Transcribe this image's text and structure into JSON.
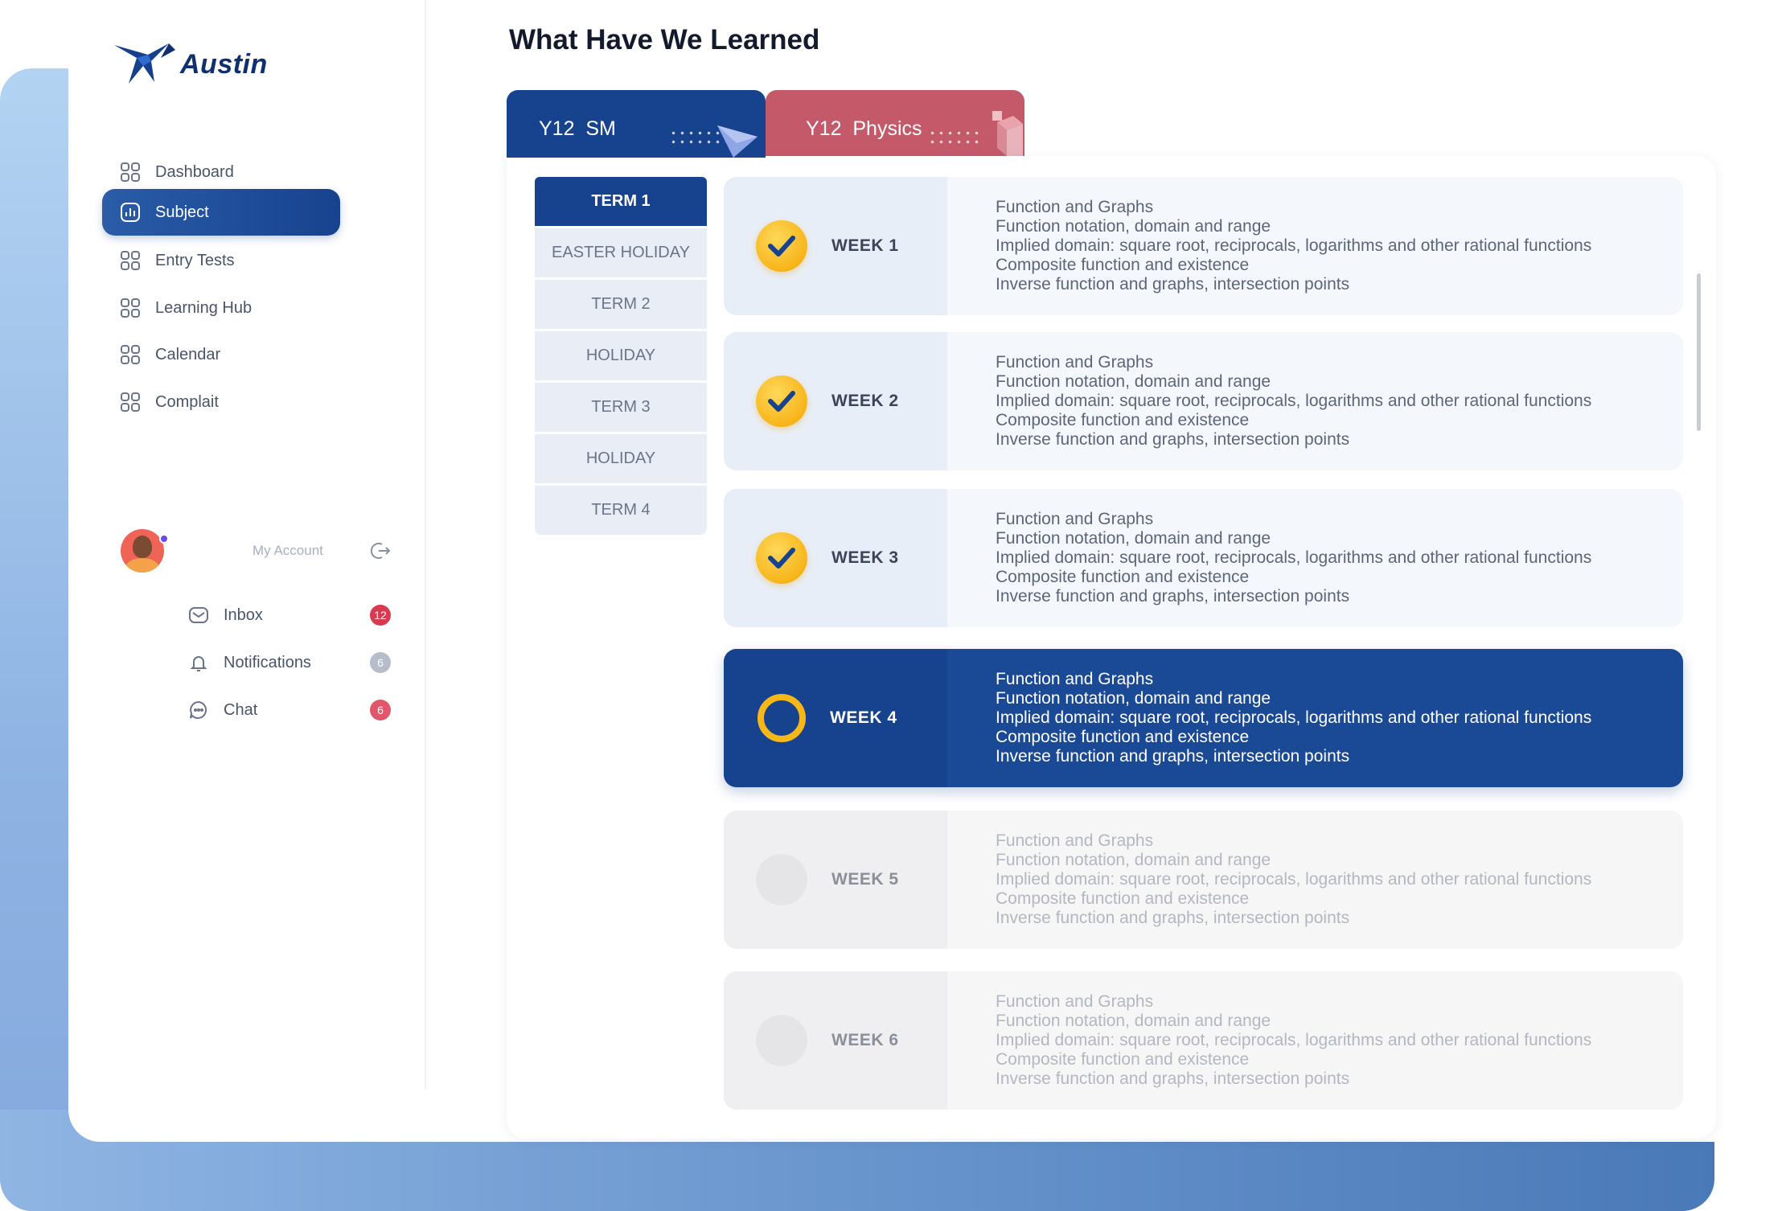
{
  "app": {
    "name": "Austin"
  },
  "nav": {
    "items": [
      {
        "label": "Dashboard"
      },
      {
        "label": "Subject"
      },
      {
        "label": "Entry Tests"
      },
      {
        "label": "Learning Hub"
      },
      {
        "label": "Calendar"
      },
      {
        "label": "Complait"
      }
    ]
  },
  "account": {
    "label": "My Account"
  },
  "side": {
    "inbox": {
      "label": "Inbox",
      "badge": "12",
      "badge_color": "#d83a52"
    },
    "notifications": {
      "label": "Notifications",
      "badge": "6",
      "badge_color": "#b6bcc9"
    },
    "chat": {
      "label": "Chat",
      "badge": "6",
      "badge_color": "#e0576c"
    }
  },
  "main": {
    "title": "What Have We Learned",
    "tabs": [
      {
        "label": "Y12  SM",
        "color": "#17428e"
      },
      {
        "label": "Y12  Physics",
        "color": "#c4596a"
      }
    ],
    "terms": [
      "TERM 1",
      "EASTER HOLIDAY",
      "TERM 2",
      "HOLIDAY",
      "TERM 3",
      "HOLIDAY",
      "TERM 4"
    ],
    "weeks": [
      {
        "label": "WEEK 1",
        "status": "done",
        "topics": [
          "Function and Graphs",
          "Function notation, domain and range",
          "Implied domain: square root, reciprocals, logarithms and other rational functions",
          "Composite function and existence",
          "Inverse function and graphs, intersection points"
        ]
      },
      {
        "label": "WEEK 2",
        "status": "done",
        "topics": [
          "Function and Graphs",
          "Function notation, domain and range",
          "Implied domain: square root, reciprocals, logarithms and other rational functions",
          "Composite function and existence",
          "Inverse function and graphs, intersection points"
        ]
      },
      {
        "label": "WEEK 3",
        "status": "done",
        "topics": [
          "Function and Graphs",
          "Function notation, domain and range",
          "Implied domain: square root, reciprocals, logarithms and other rational functions",
          "Composite function and existence",
          "Inverse function and graphs, intersection points"
        ]
      },
      {
        "label": "WEEK 4",
        "status": "current",
        "topics": [
          "Function and Graphs",
          "Function notation, domain and range",
          "Implied domain: square root, reciprocals, logarithms and other rational functions",
          "Composite function and existence",
          "Inverse function and graphs, intersection points"
        ]
      },
      {
        "label": "WEEK 5",
        "status": "todo",
        "topics": [
          "Function and Graphs",
          "Function notation, domain and range",
          "Implied domain: square root, reciprocals, logarithms and other rational functions",
          "Composite function and existence",
          "Inverse function and graphs, intersection points"
        ]
      },
      {
        "label": "WEEK 6",
        "status": "todo",
        "topics": [
          "Function and Graphs",
          "Function notation, domain and range",
          "Implied domain: square root, reciprocals, logarithms and other rational functions",
          "Composite function and existence",
          "Inverse function and graphs, intersection points"
        ]
      }
    ]
  },
  "icons": {
    "nav": "grid-icon",
    "subject": "chart-icon",
    "logout": "logout-icon",
    "inbox": "mail-icon",
    "notifications": "bell-icon",
    "chat": "chat-icon",
    "done": "check-icon"
  }
}
